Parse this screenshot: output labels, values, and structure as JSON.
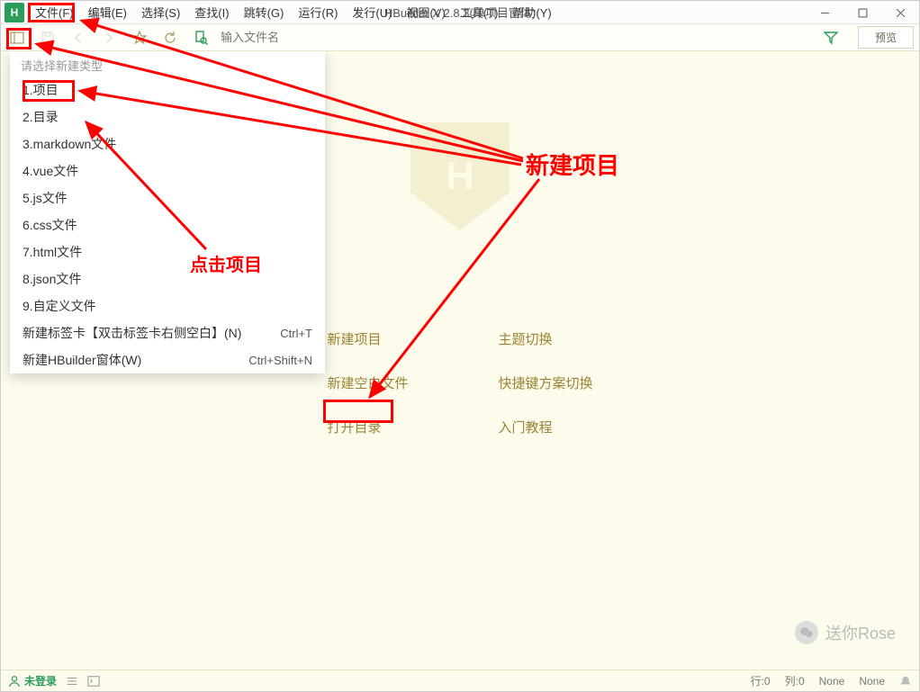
{
  "app": {
    "title": "HBuilder X 2.8.3(单项目窗体)"
  },
  "menu": {
    "items": [
      {
        "label": "文件(F)"
      },
      {
        "label": "编辑(E)"
      },
      {
        "label": "选择(S)"
      },
      {
        "label": "查找(I)"
      },
      {
        "label": "跳转(G)"
      },
      {
        "label": "运行(R)"
      },
      {
        "label": "发行(U)"
      },
      {
        "label": "视图(V)"
      },
      {
        "label": "工具(T)"
      },
      {
        "label": "帮助(Y)"
      }
    ]
  },
  "toolbar": {
    "search_placeholder": "输入文件名",
    "preview_label": "预览"
  },
  "popup": {
    "header": "请选择新建类型",
    "items": [
      {
        "label": "1.项目",
        "shortcut": ""
      },
      {
        "label": "2.目录",
        "shortcut": ""
      },
      {
        "label": "3.markdown文件",
        "shortcut": ""
      },
      {
        "label": "4.vue文件",
        "shortcut": ""
      },
      {
        "label": "5.js文件",
        "shortcut": ""
      },
      {
        "label": "6.css文件",
        "shortcut": ""
      },
      {
        "label": "7.html文件",
        "shortcut": ""
      },
      {
        "label": "8.json文件",
        "shortcut": ""
      },
      {
        "label": "9.自定义文件",
        "shortcut": ""
      },
      {
        "label": "新建标签卡【双击标签卡右侧空白】(N)",
        "shortcut": "Ctrl+T"
      },
      {
        "label": "新建HBuilder窗体(W)",
        "shortcut": "Ctrl+Shift+N"
      }
    ]
  },
  "welcome": {
    "logo_letter": "H",
    "links": {
      "new_project": "新建项目",
      "theme_switch": "主题切换",
      "new_blank_file": "新建空白文件",
      "shortcut_scheme": "快捷键方案切换",
      "open_dir": "打开目录",
      "tutorial": "入门教程"
    }
  },
  "watermark": {
    "text": "送你Rose"
  },
  "status": {
    "login": "未登录",
    "row_label": "行:",
    "row_val": "0",
    "col_label": "列:",
    "col_val": "0",
    "none1": "None",
    "none2": "None"
  },
  "annotations": {
    "big_label": "新建项目",
    "click_label": "点击项目"
  }
}
